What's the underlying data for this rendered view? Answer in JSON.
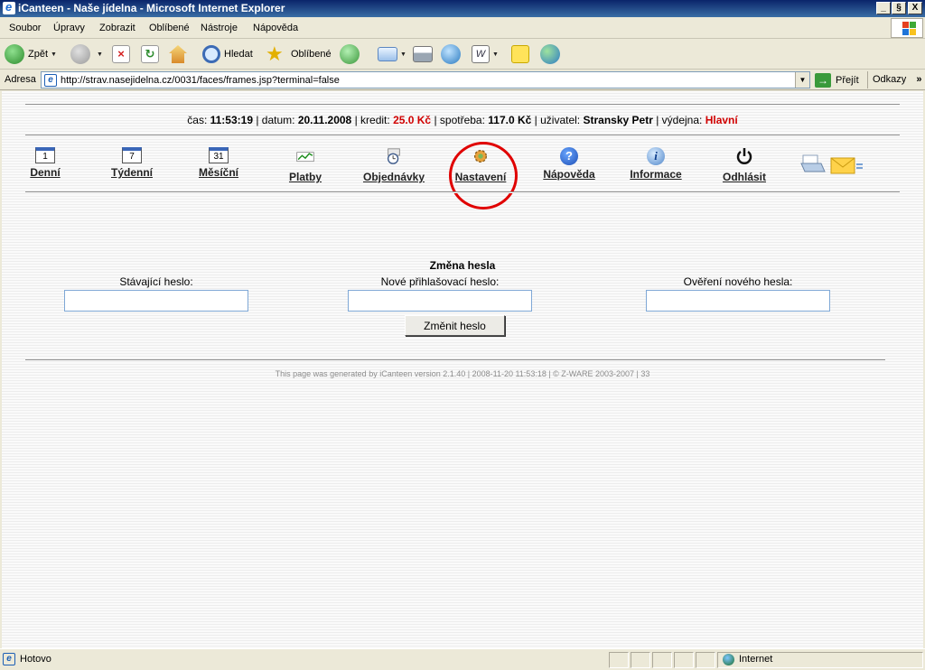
{
  "window": {
    "title": "iCanteen - Naše jídelna - Microsoft Internet Explorer",
    "buttons": {
      "minimize": "_",
      "maximize": "§",
      "close": "X"
    }
  },
  "menubar": [
    "Soubor",
    "Úpravy",
    "Zobrazit",
    "Oblíbené",
    "Nástroje",
    "Nápověda"
  ],
  "toolbar": {
    "back_label": "Zpět",
    "search_label": "Hledat",
    "favorites_label": "Oblíbené"
  },
  "address": {
    "label": "Adresa",
    "url": "http://strav.nasejidelna.cz/0031/faces/frames.jsp?terminal=false",
    "go_label": "Přejít",
    "links_label": "Odkazy"
  },
  "info": {
    "time_label": "čas:",
    "time_value": "11:53:19",
    "date_label": "| datum:",
    "date_value": "20.11.2008",
    "credit_label": "| kredit:",
    "credit_value": "25.0 Kč",
    "spend_label": "| spotřeba:",
    "spend_value": "117.0 Kč",
    "user_label": "| uživatel:",
    "user_value": "Stransky Petr",
    "counter_label": "| výdejna:",
    "counter_value": "Hlavní"
  },
  "nav": {
    "daily": {
      "label": "Denní",
      "cal": "1"
    },
    "weekly": {
      "label": "Týdenní",
      "cal": "7"
    },
    "monthly": {
      "label": "Měsíční",
      "cal": "31"
    },
    "payments": "Platby",
    "orders": "Objednávky",
    "settings": "Nastavení",
    "help": "Nápověda",
    "info": "Informace",
    "logout": "Odhlásit"
  },
  "form": {
    "title": "Změna hesla",
    "current_label": "Stávající heslo:",
    "new_label": "Nové přihlašovací heslo:",
    "verify_label": "Ověření nového hesla:",
    "current_value": "",
    "new_value": "",
    "verify_value": "",
    "submit_label": "Změnit heslo"
  },
  "footer": "This page was generated by iCanteen version 2.1.40 | 2008-11-20 11:53:18 | © Z-WARE 2003-2007 | 33",
  "status": {
    "text": "Hotovo",
    "zone": "Internet"
  },
  "colors": {
    "title_bar": "#0a246a",
    "accent_red": "#d00000",
    "highlight_circle": "#e00000"
  }
}
